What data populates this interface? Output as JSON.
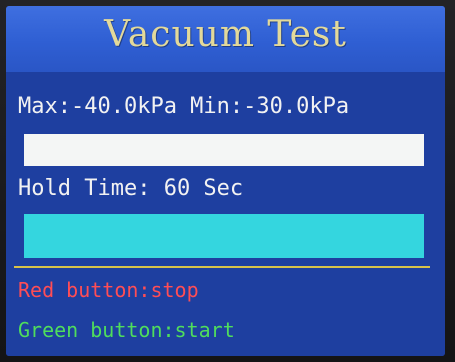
{
  "title": "Vacuum Test",
  "pressure": {
    "text": "Max:-40.0kPa Min:-30.0kPa"
  },
  "hold": {
    "text": "Hold Time: 60 Sec"
  },
  "instructions": {
    "red": "Red button:stop",
    "green": "Green button:start"
  },
  "colors": {
    "screen_bg": "#1e3fa0",
    "title_bar": "#2f5fd3",
    "title_text": "#e3d99a",
    "white_bar": "#f4f6f5",
    "cyan_bar": "#34d6df",
    "divider": "#d8c24a",
    "red_text": "#ff4d55",
    "green_text": "#4fdd5c"
  }
}
